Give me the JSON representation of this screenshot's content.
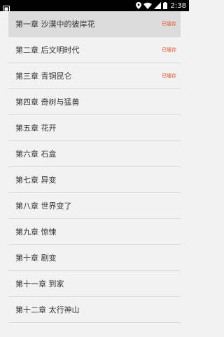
{
  "status_bar": {
    "time": "2:38",
    "icons": [
      "app-icon",
      "location-icon",
      "wifi-icon",
      "signal-icon",
      "battery-icon"
    ]
  },
  "chapters": [
    {
      "title": "第一章 沙漠中的彼岸花",
      "badge": "已缓存",
      "selected": true
    },
    {
      "title": "第二章 后文明时代",
      "badge": "已缓存"
    },
    {
      "title": "第三章 青铜昆仑",
      "badge": "已缓存"
    },
    {
      "title": "第四章 奇树与猛兽",
      "badge": ""
    },
    {
      "title": "第五章 花开",
      "badge": ""
    },
    {
      "title": "第六章 石盒",
      "badge": ""
    },
    {
      "title": "第七章 异变",
      "badge": ""
    },
    {
      "title": "第八章 世界变了",
      "badge": ""
    },
    {
      "title": "第九章 惊悚",
      "badge": ""
    },
    {
      "title": "第十章 剧变",
      "badge": ""
    },
    {
      "title": "第十一章 到家",
      "badge": ""
    },
    {
      "title": "第十二章 太行神山",
      "badge": ""
    }
  ],
  "colors": {
    "badge": "#e8562a",
    "selected_row": "#dcdcdc",
    "background": "#f2f2f2"
  }
}
